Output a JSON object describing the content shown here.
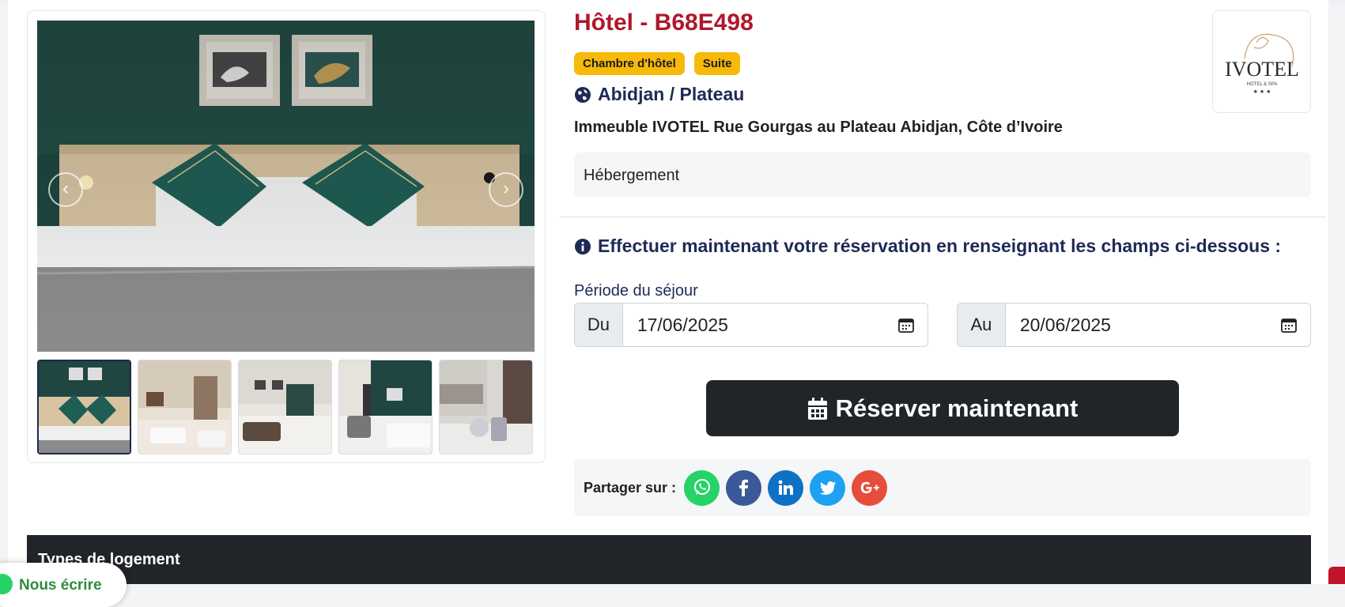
{
  "listing": {
    "title": "Hôtel - B68E498",
    "badges": [
      "Chambre d'hôtel",
      "Suite"
    ],
    "location": "Abidjan / Plateau",
    "address": "Immeuble IVOTEL Rue Gourgas au Plateau Abidjan, Côte d’Ivoire",
    "category": "Hébergement",
    "logo": {
      "brand": "IVOTEL",
      "sub": "HOTEL & SPA",
      "stars": "★ ★ ★"
    }
  },
  "gallery": {
    "prev_glyph": "‹",
    "next_glyph": "›",
    "thumbnail_count": 5
  },
  "booking": {
    "notice": "Effectuer maintenant votre réservation en renseignant les champs ci-dessous :",
    "period_label": "Période du séjour",
    "from_label": "Du",
    "from_value": "17/06/2025",
    "to_label": "Au",
    "to_value": "20/06/2025",
    "reserve_label": "Réserver maintenant"
  },
  "share": {
    "label": "Partager sur :",
    "networks": [
      {
        "name": "whatsapp",
        "color": "#25d366"
      },
      {
        "name": "facebook",
        "color": "#3b5998"
      },
      {
        "name": "linkedin",
        "color": "#0e72c4"
      },
      {
        "name": "twitter",
        "color": "#1da1f2"
      },
      {
        "name": "google-plus",
        "color": "#e74c3c"
      }
    ]
  },
  "section": {
    "types_title": "Types de logement"
  },
  "chat": {
    "label": "Nous écrire"
  },
  "colors": {
    "title_red": "#b0172c",
    "navy": "#1e2a56",
    "badge_yellow": "#f7b90a",
    "dark": "#212529"
  }
}
